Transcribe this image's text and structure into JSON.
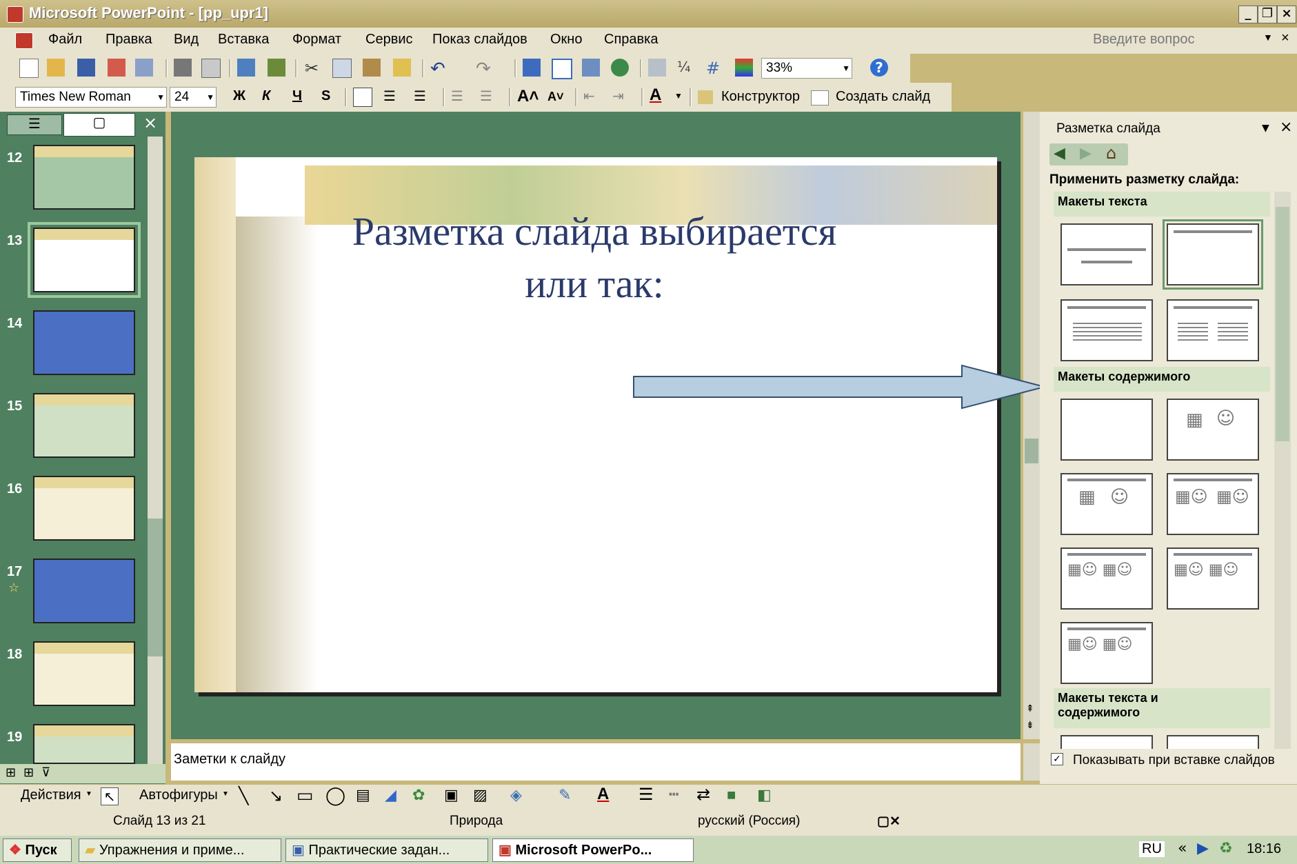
{
  "window": {
    "title": "Microsoft PowerPoint - [pp_upr1]"
  },
  "menu": {
    "items": [
      "Файл",
      "Правка",
      "Вид",
      "Вставка",
      "Формат",
      "Сервис",
      "Показ слайдов",
      "Окно",
      "Справка"
    ],
    "help_placeholder": "Введите вопрос"
  },
  "toolbar": {
    "zoom": "33%"
  },
  "formatting": {
    "font": "Times New Roman",
    "size": "24",
    "bold": "Ж",
    "italic": "К",
    "underline": "Ч",
    "shadow": "S",
    "designer": "Конструктор",
    "new_slide": "Создать слайд"
  },
  "slides": {
    "numbers": [
      "12",
      "13",
      "14",
      "15",
      "16",
      "17",
      "18",
      "19"
    ],
    "selected": "13"
  },
  "slide": {
    "title_line1": "Разметка слайда выбирается",
    "title_line2": "или так:"
  },
  "notes": {
    "placeholder": "Заметки к слайду"
  },
  "taskpane": {
    "title": "Разметка слайда",
    "apply_label": "Применить разметку слайда:",
    "section_text": "Макеты текста",
    "section_content": "Макеты содержимого",
    "section_text_content_1": "Макеты текста и",
    "section_text_content_2": "содержимого",
    "show_checkbox": "Показывать при вставке слайдов"
  },
  "drawing": {
    "actions": "Действия",
    "autoshapes": "Автофигуры"
  },
  "status": {
    "slide": "Слайд 13 из 21",
    "design": "Природа",
    "language": "русский (Россия)"
  },
  "taskbar": {
    "start": "Пуск",
    "btn1": "Упражнения и приме...",
    "btn2": "Практические задан...",
    "btn3": "Microsoft PowerPo...",
    "lang": "RU",
    "clock": "18:16"
  },
  "colors": {
    "accent": "#4f8060",
    "title_text": "#2b3a6b",
    "arrow": "#b7cde0"
  }
}
